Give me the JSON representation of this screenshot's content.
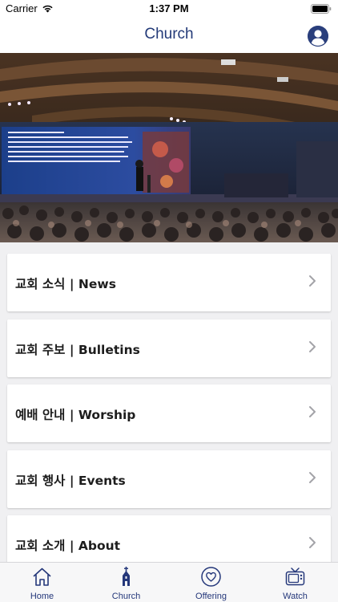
{
  "status_bar": {
    "carrier": "Carrier",
    "time": "1:37 PM"
  },
  "nav": {
    "title": "Church",
    "profile_icon": "person-circle-icon"
  },
  "hero": {
    "description_icon": "sanctuary-photo"
  },
  "menu": {
    "items": [
      {
        "label": "교회 소식 | News",
        "icon": "chevron-right-icon"
      },
      {
        "label": "교회 주보 | Bulletins",
        "icon": "chevron-right-icon"
      },
      {
        "label": "예배 안내 | Worship",
        "icon": "chevron-right-icon"
      },
      {
        "label": "교회 행사 | Events",
        "icon": "chevron-right-icon"
      },
      {
        "label": "교회 소개 | About",
        "icon": "chevron-right-icon"
      }
    ]
  },
  "tabs": [
    {
      "label": "Home",
      "icon": "home-icon"
    },
    {
      "label": "Church",
      "icon": "church-icon",
      "active": true
    },
    {
      "label": "Offering",
      "icon": "heart-icon"
    },
    {
      "label": "Watch",
      "icon": "tv-icon"
    }
  ],
  "colors": {
    "accent": "#233a78",
    "tab_text": "#24377a",
    "background": "#f0f0f2"
  }
}
